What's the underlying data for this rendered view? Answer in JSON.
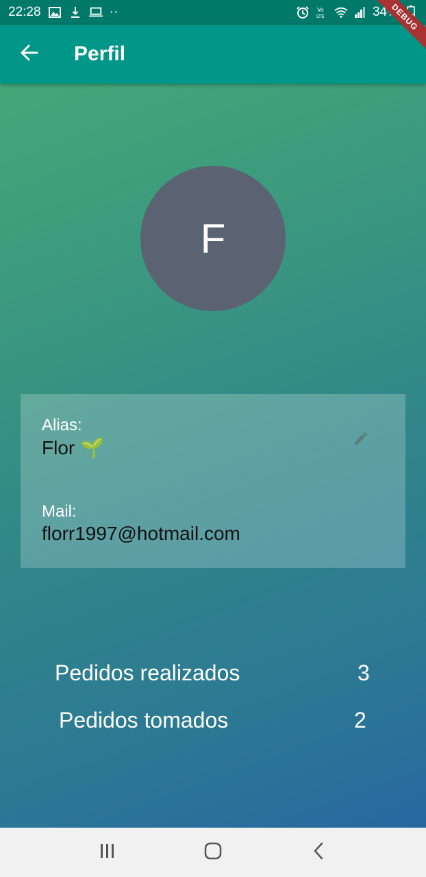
{
  "status_bar": {
    "time": "22:28",
    "battery_percent": "34%",
    "dots": "··",
    "icons_left": [
      "image-icon",
      "download-icon",
      "laptop-icon"
    ],
    "icons_right": [
      "alarm-icon",
      "volte-icon",
      "wifi-icon",
      "signal-icon",
      "battery-icon"
    ]
  },
  "debug_banner": "DEBUG",
  "app_bar": {
    "title": "Perfil",
    "back_icon": "arrow-back-icon"
  },
  "profile": {
    "avatar_initial": "F",
    "alias_label": "Alias:",
    "alias_value": "Flor 🌱",
    "mail_label": "Mail:",
    "mail_value": "florr1997@hotmail.com",
    "edit_icon": "pencil-icon"
  },
  "stats": {
    "orders_made_label": "Pedidos realizados",
    "orders_made_value": "3",
    "orders_taken_label": "Pedidos tomados",
    "orders_taken_value": "2"
  },
  "nav_bar": {
    "icons": [
      "recent-apps-icon",
      "home-icon",
      "back-icon"
    ]
  },
  "colors": {
    "app_bar": "#009688",
    "status_bar": "#00796b",
    "avatar_bg": "#5b6272",
    "nav_bar": "#f1f1f1"
  }
}
